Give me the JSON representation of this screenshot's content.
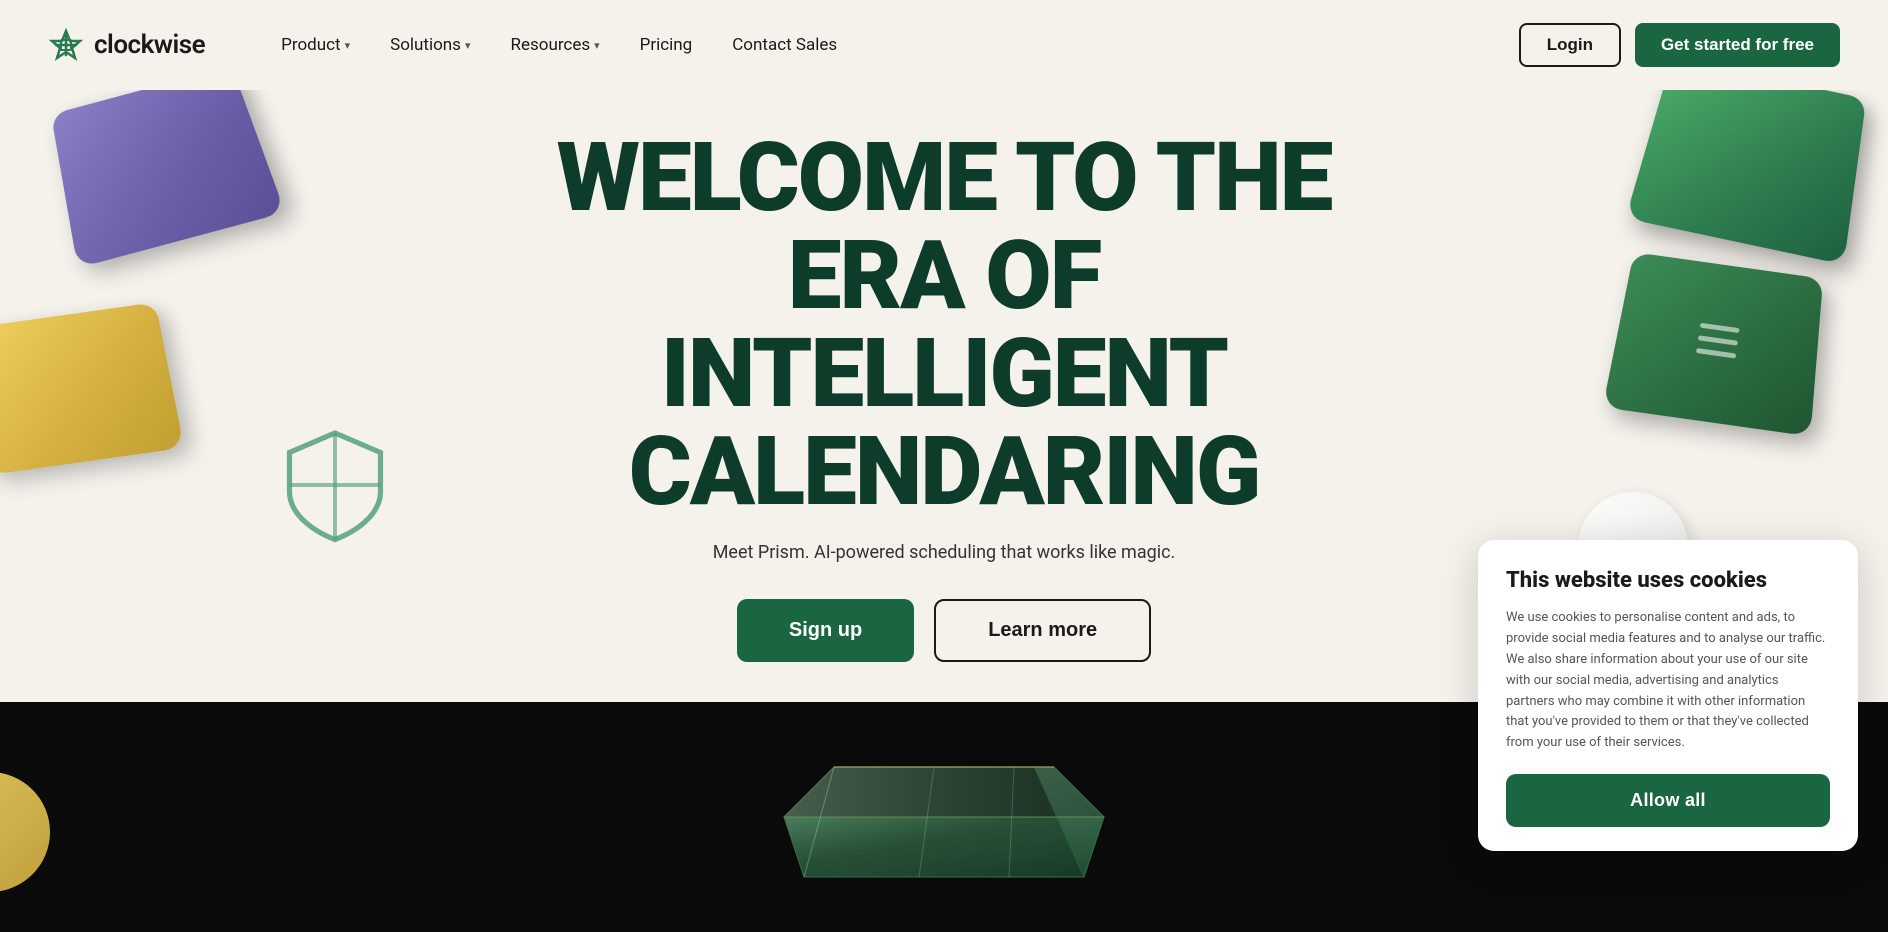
{
  "brand": {
    "name": "clockwise",
    "logo_icon": "◈"
  },
  "nav": {
    "links": [
      {
        "label": "Product",
        "has_dropdown": true
      },
      {
        "label": "Solutions",
        "has_dropdown": true
      },
      {
        "label": "Resources",
        "has_dropdown": true
      },
      {
        "label": "Pricing",
        "has_dropdown": false
      },
      {
        "label": "Contact Sales",
        "has_dropdown": false
      }
    ],
    "login_label": "Login",
    "cta_label": "Get started for free"
  },
  "hero": {
    "title_line1": "WELCOME TO THE",
    "title_line2": "ERA OF INTELLIGENT",
    "title_line3": "CALENDARING",
    "subtitle": "Meet Prism. AI-powered scheduling that works like magic.",
    "signup_label": "Sign up",
    "learnmore_label": "Learn more"
  },
  "cookie": {
    "title": "This website uses cookies",
    "body": "We use cookies to personalise content and ads, to provide social media features and to analyse our traffic. We also share information about your use of our site with our social media, advertising and analytics partners who may combine it with other information that you've provided to them or that they've collected from your use of their services.",
    "allow_label": "Allow all"
  }
}
